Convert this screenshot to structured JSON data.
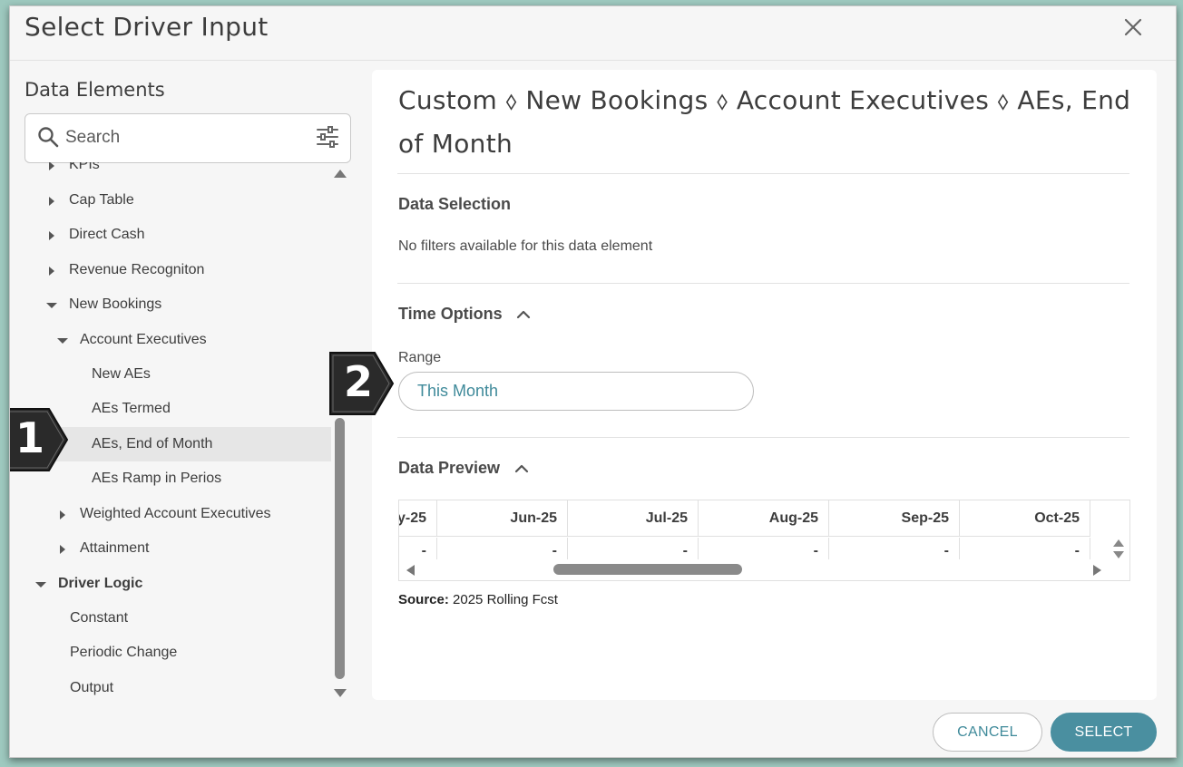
{
  "dialog": {
    "title": "Select Driver Input",
    "close_icon": "close-icon"
  },
  "left_pane": {
    "heading": "Data Elements",
    "search": {
      "placeholder": "Search",
      "value": ""
    },
    "tree": [
      {
        "label": "KPIs",
        "caret": "right",
        "level": 0,
        "partial": true
      },
      {
        "label": "Cap Table",
        "caret": "right",
        "level": 0
      },
      {
        "label": "Direct Cash",
        "caret": "right",
        "level": 0
      },
      {
        "label": "Revenue Recogniton",
        "caret": "right",
        "level": 0
      },
      {
        "label": "New Bookings",
        "caret": "down",
        "level": 0
      },
      {
        "label": "Account Executives",
        "caret": "down",
        "level": 1
      },
      {
        "label": "New AEs",
        "caret": "none",
        "level": 2
      },
      {
        "label": "AEs Termed",
        "caret": "none",
        "level": 2
      },
      {
        "label": "AEs, End of Month",
        "caret": "none",
        "level": 2,
        "selected": true
      },
      {
        "label": "AEs Ramp in Perios",
        "caret": "none",
        "level": 2
      },
      {
        "label": "Weighted Account Executives",
        "caret": "right",
        "level": 1
      },
      {
        "label": "Attainment",
        "caret": "right",
        "level": 1
      },
      {
        "label": "Driver Logic",
        "caret": "down",
        "level": -1,
        "bold": true
      },
      {
        "label": "Constant",
        "caret": "none",
        "level": 0
      },
      {
        "label": "Periodic Change",
        "caret": "none",
        "level": 0
      },
      {
        "label": "Output",
        "caret": "none",
        "level": 0
      }
    ]
  },
  "right_pane": {
    "breadcrumb_title": "Custom ⬨ New Bookings ⬨ Account Executives ⬨ AEs, End of Month",
    "data_selection": {
      "heading": "Data Selection",
      "message": "No filters available for this data element"
    },
    "time_options": {
      "heading": "Time Options",
      "range_label": "Range",
      "range_value": "This Month"
    },
    "data_preview": {
      "heading": "Data Preview",
      "columns": [
        "y-25",
        "Jun-25",
        "Jul-25",
        "Aug-25",
        "Sep-25",
        "Oct-25"
      ],
      "values": [
        "-",
        "-",
        "-",
        "-",
        "-",
        "-"
      ]
    },
    "source": {
      "label": "Source:",
      "value": "2025 Rolling Fcst"
    }
  },
  "footer": {
    "cancel_label": "CANCEL",
    "select_label": "SELECT"
  },
  "callouts": [
    "1",
    "2"
  ],
  "colors": {
    "accent": "#4a8fa0",
    "accent_text": "#3f8a9a",
    "frame": "#9ec9bf",
    "selected_row": "#e6e6e6"
  }
}
